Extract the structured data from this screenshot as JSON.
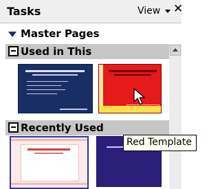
{
  "header": {
    "title": "Tasks",
    "view_label": "View",
    "close_glyph": "✕"
  },
  "master_pages": {
    "label": "Master Pages"
  },
  "sections": [
    {
      "label": "Used in This Presentation"
    },
    {
      "label": "Recently Used"
    }
  ],
  "tooltip": {
    "text": "Red Template"
  },
  "icons": {
    "collapse": "triangle-down-icon",
    "section_toggle": "minus-box-icon",
    "view_dropdown": "chevron-down-icon",
    "close": "close-icon",
    "cursor": "mouse-pointer-icon",
    "scroll_up": "scroll-up-arrow-icon"
  },
  "colors": {
    "section_bar": "#c6c6c6",
    "header_bg": "#efefef",
    "master_triangle": "#1c2c7a",
    "tooltip_bg": "#fffff2",
    "selected_border": "#2c3a9c"
  }
}
